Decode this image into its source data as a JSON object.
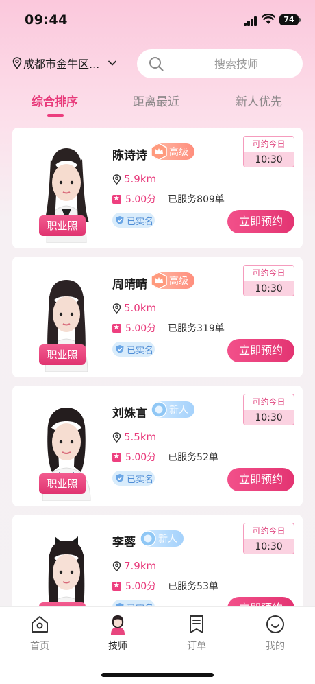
{
  "status_bar": {
    "time": "09:44",
    "battery": "74"
  },
  "header": {
    "location": "成都市金牛区...",
    "search_placeholder": "搜索技师"
  },
  "tabs": [
    {
      "label": "综合排序",
      "active": true
    },
    {
      "label": "距离最近",
      "active": false
    },
    {
      "label": "新人优先",
      "active": false
    }
  ],
  "therapists": [
    {
      "name": "陈诗诗",
      "level": "高级",
      "level_type": "senior",
      "distance": "5.9km",
      "score": "5.00分",
      "served": "已服务809单",
      "verified": "已实名",
      "avail_label": "可约今日",
      "avail_time": "10:30",
      "photo_badge": "职业照",
      "book": "立即预约"
    },
    {
      "name": "周晴晴",
      "level": "高级",
      "level_type": "senior",
      "distance": "5.0km",
      "score": "5.00分",
      "served": "已服务319单",
      "verified": "已实名",
      "avail_label": "可约今日",
      "avail_time": "10:30",
      "photo_badge": "职业照",
      "book": "立即预约"
    },
    {
      "name": "刘姝言",
      "level": "新人",
      "level_type": "newbie",
      "distance": "5.5km",
      "score": "5.00分",
      "served": "已服务52单",
      "verified": "已实名",
      "avail_label": "可约今日",
      "avail_time": "10:30",
      "photo_badge": "职业照",
      "book": "立即预约"
    },
    {
      "name": "李蓉",
      "level": "新人",
      "level_type": "newbie",
      "distance": "7.9km",
      "score": "5.00分",
      "served": "已服务53单",
      "verified": "已实名",
      "avail_label": "可约今日",
      "avail_time": "10:30",
      "photo_badge": "职业照",
      "book": "立即预约"
    }
  ],
  "tabbar": [
    {
      "label": "首页",
      "icon": "home-icon",
      "active": false
    },
    {
      "label": "技师",
      "icon": "therapist-avatar-icon",
      "active": true
    },
    {
      "label": "订单",
      "icon": "order-icon",
      "active": false
    },
    {
      "label": "我的",
      "icon": "profile-icon",
      "active": false
    }
  ],
  "colors": {
    "accent": "#e8397a",
    "tag_senior": "#ff8e7d",
    "tag_newbie": "#a4d1fb"
  }
}
